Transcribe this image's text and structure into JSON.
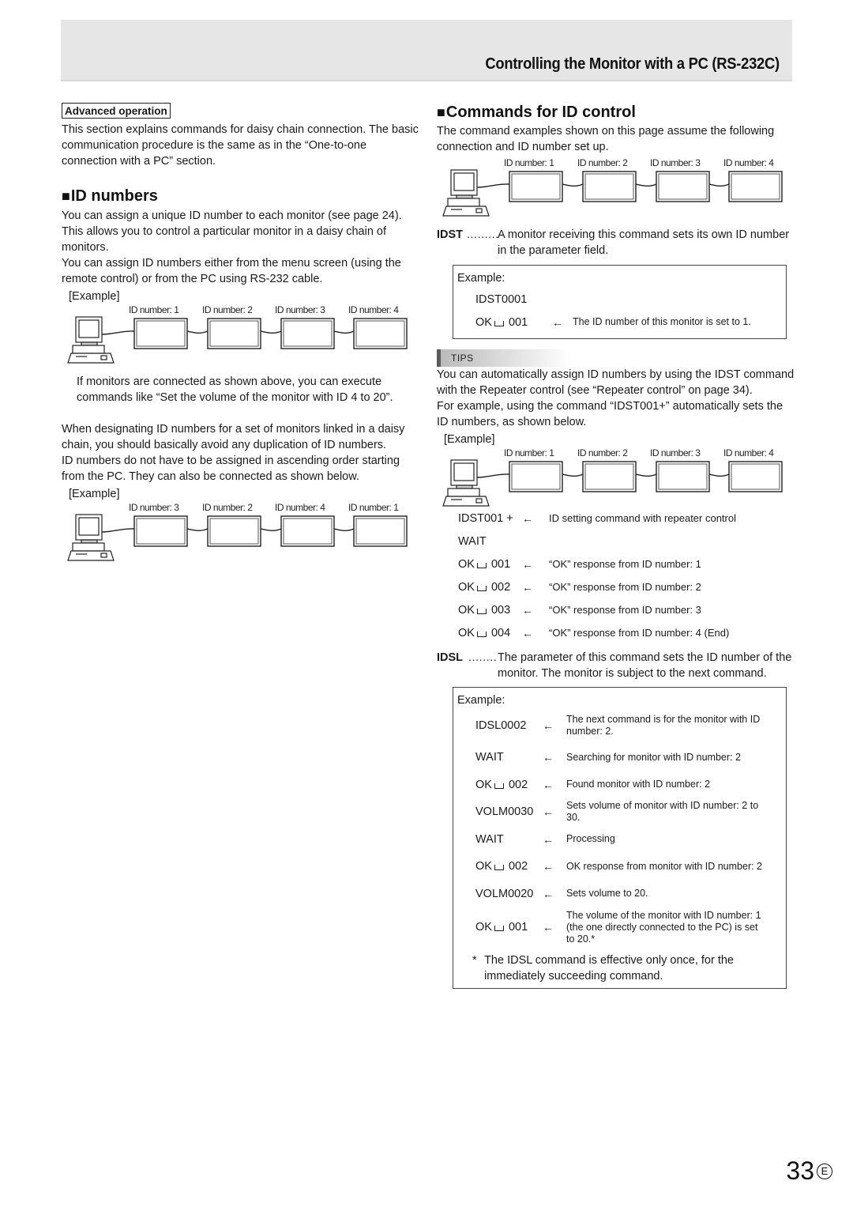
{
  "header": {
    "title": "Controlling the Monitor with a PC (RS-232C)"
  },
  "left": {
    "badge": "Advanced operation",
    "intro": "This section explains commands for daisy chain connection. The basic communication procedure is the same as in the “One-to-one connection with a PC” section.",
    "heading_marker": "■",
    "heading": "ID numbers",
    "para1": "You can assign a unique ID number to each monitor (see page 24). This allows you to control a particular monitor in a daisy chain of monitors.",
    "para2": "You can assign ID numbers either from the menu screen (using the remote control) or from the PC using RS-232 cable.",
    "example1_label": "[Example]",
    "diagram1_ids": [
      "ID number: 1",
      "ID number: 2",
      "ID number: 3",
      "ID number: 4"
    ],
    "note1": "If monitors are connected as shown above, you can execute commands like “Set the volume of the monitor with ID 4 to 20”.",
    "para3": "When designating ID numbers for a set of monitors linked in a daisy chain, you should basically avoid any duplication of ID numbers.",
    "para4": "ID numbers do not have to be assigned in ascending order starting from the PC. They can also be connected as shown below.",
    "example2_label": "[Example]",
    "diagram2_ids": [
      "ID number: 3",
      "ID number: 2",
      "ID number: 4",
      "ID number: 1"
    ]
  },
  "right": {
    "heading_marker": "■",
    "heading": "Commands for ID control",
    "intro": "The command examples shown on this page assume the following connection and ID number set up.",
    "diagram_ids": [
      "ID number: 1",
      "ID number: 2",
      "ID number: 3",
      "ID number: 4"
    ],
    "idst": {
      "key": "IDST",
      "dots": ".........",
      "desc": "A monitor receiving this command sets its own ID number in the parameter field.",
      "example_label": "Example:",
      "command": "IDST0001",
      "response_ok": "OK",
      "response_val": "001",
      "arrow": "←",
      "response_note": "The ID number of this monitor is set to 1."
    },
    "tips": {
      "label": "TIPS",
      "para1": "You can automatically assign ID numbers by using the IDST command with the Repeater control (see “Repeater control” on page 34).",
      "para2": "For example, using the command “IDST001+” automatically sets the ID numbers, as shown below.",
      "example_label": "[Example]",
      "diagram_ids": [
        "ID number: 1",
        "ID number: 2",
        "ID number: 3",
        "ID number: 4"
      ],
      "sequence": [
        {
          "cmd": "IDST001 +",
          "ok": false,
          "arrow": "←",
          "note": "ID setting command with repeater control"
        },
        {
          "cmd": "WAIT",
          "ok": false,
          "arrow": "",
          "note": ""
        },
        {
          "cmd": "001",
          "ok": true,
          "arrow": "←",
          "note": "“OK” response from ID number: 1"
        },
        {
          "cmd": "002",
          "ok": true,
          "arrow": "←",
          "note": "“OK” response from ID number: 2"
        },
        {
          "cmd": "003",
          "ok": true,
          "arrow": "←",
          "note": "“OK” response from ID number: 3"
        },
        {
          "cmd": "004",
          "ok": true,
          "arrow": "←",
          "note": "“OK” response from ID number: 4 (End)"
        }
      ]
    },
    "idsl": {
      "key": "IDSL",
      "dots": "........",
      "desc": "The parameter of this command sets the ID number of the monitor. The monitor is subject to the next command.",
      "example_label": "Example:",
      "rows": [
        {
          "cmd": "IDSL0002",
          "ok": false,
          "arrow": "←",
          "note": "The next command is for the monitor with ID number: 2."
        },
        {
          "cmd": "WAIT",
          "ok": false,
          "arrow": "←",
          "note": "Searching for monitor with ID number: 2"
        },
        {
          "cmd": "002",
          "ok": true,
          "arrow": "←",
          "note": "Found monitor with ID number: 2"
        },
        {
          "cmd": "VOLM0030",
          "ok": false,
          "arrow": "←",
          "note": "Sets volume of monitor with ID number: 2 to 30."
        },
        {
          "cmd": "WAIT",
          "ok": false,
          "arrow": "←",
          "note": "Processing"
        },
        {
          "cmd": "002",
          "ok": true,
          "arrow": "←",
          "note": "OK response from monitor with ID number: 2"
        },
        {
          "cmd": "VOLM0020",
          "ok": false,
          "arrow": "←",
          "note": "Sets volume to 20."
        },
        {
          "cmd": "001",
          "ok": true,
          "arrow": "←",
          "note": "The volume of the monitor with ID number: 1 (the one directly connected to the PC) is set to 20.*"
        }
      ],
      "footnote_mark": "*",
      "footnote": "The IDSL command is effective only once, for the immediately succeeding command."
    }
  },
  "footer": {
    "page_number": "33",
    "language_mark": "E"
  },
  "icons": {
    "pc": "pc-computer-icon",
    "monitor": "display-monitor-icon",
    "cable": "cable-connection"
  }
}
